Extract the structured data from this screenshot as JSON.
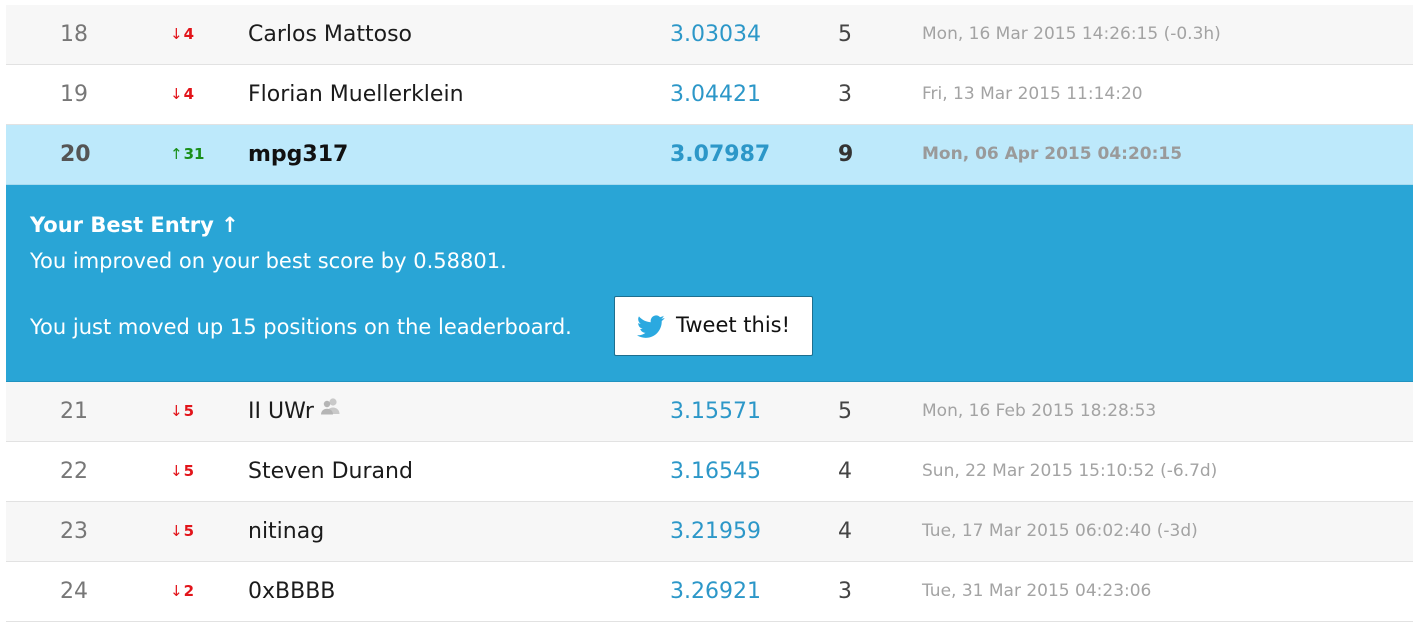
{
  "rows_before": [
    {
      "rank": "18",
      "change": "4",
      "direction": "down",
      "name": "Carlos Mattoso",
      "score": "3.03034",
      "entries": "5",
      "last": "Mon, 16 Mar 2015 14:26:15 (-0.3h)"
    },
    {
      "rank": "19",
      "change": "4",
      "direction": "down",
      "name": "Florian Muellerklein",
      "score": "3.04421",
      "entries": "3",
      "last": "Fri, 13 Mar 2015 11:14:20"
    }
  ],
  "current": {
    "rank": "20",
    "change": "31",
    "direction": "up",
    "name": "mpg317",
    "score": "3.07987",
    "entries": "9",
    "last": "Mon, 06 Apr 2015 04:20:15"
  },
  "notice": {
    "title": "Your Best Entry ↑",
    "line1": "You improved on your best score by 0.58801.",
    "line2": "You just moved up 15 positions on the leaderboard.",
    "tweet_label": "Tweet this!",
    "tweet_icon": "twitter-bird-icon",
    "bg_color": "#29a5d6"
  },
  "rows_after": [
    {
      "rank": "21",
      "change": "5",
      "direction": "down",
      "name": "II UWr",
      "team": true,
      "score": "3.15571",
      "entries": "5",
      "last": "Mon, 16 Feb 2015 18:28:53"
    },
    {
      "rank": "22",
      "change": "5",
      "direction": "down",
      "name": "Steven Durand",
      "score": "3.16545",
      "entries": "4",
      "last": "Sun, 22 Mar 2015 15:10:52 (-6.7d)"
    },
    {
      "rank": "23",
      "change": "5",
      "direction": "down",
      "name": "nitinag",
      "score": "3.21959",
      "entries": "4",
      "last": "Tue, 17 Mar 2015 06:02:40 (-3d)"
    },
    {
      "rank": "24",
      "change": "2",
      "direction": "down",
      "name": "0xBBBB",
      "score": "3.26921",
      "entries": "3",
      "last": "Tue, 31 Mar 2015 04:23:06"
    }
  ],
  "arrows": {
    "up": "↑",
    "down": "↓"
  },
  "colors": {
    "score_link": "#2c97c8",
    "move_down": "#e2141a",
    "move_up": "#1a8f1a",
    "current_row_bg": "#bde9fb"
  }
}
